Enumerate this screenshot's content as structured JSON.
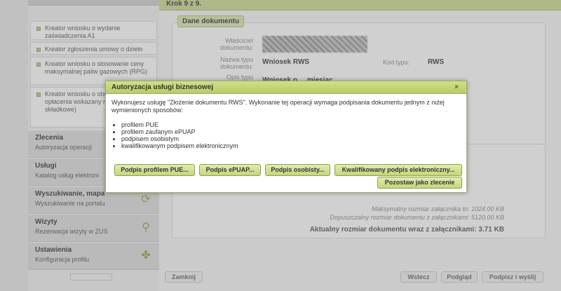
{
  "sidebar": {
    "subitems": [
      "Kreator wniosku o wydanie zaświadczenia A1",
      "Kreator zgłoszenia umowy o dzieło",
      "Kreator wniosku o stosowanie ceny maksymalnej paliw gazowych (RPG)",
      "Kreator wniosku o obowiązku opłacenia wskazany miesiąc – składkowe)"
    ],
    "sections": [
      {
        "title": "Zlecenia",
        "subtitle": "Autoryzacja operacji",
        "icon": ""
      },
      {
        "title": "Usługi",
        "subtitle": "Katalog usług elektroni",
        "icon": ""
      },
      {
        "title": "Wyszukiwanie, mapa",
        "subtitle": "Wyszukiwanie na portalu",
        "icon": "refresh-icon"
      },
      {
        "title": "Wizyty",
        "subtitle": "Rezerwacja wizyty w ZUS",
        "icon": "walking-person-icon"
      },
      {
        "title": "Ustawienia",
        "subtitle": "Konfiguracja profilu",
        "icon": "puzzle-icon"
      }
    ]
  },
  "main": {
    "step": "Krok 9 z 9.",
    "panel_title": "Dane dokumentu",
    "fields": {
      "owner_label": "Właściciel dokumentu:",
      "type_name_label": "Nazwa typu dokumentu:",
      "type_name_value": "Wniosek RWS",
      "type_code_label": "Kod typu:",
      "type_code_value": "RWS",
      "desc_label": "Opis typu",
      "desc_value": "Wniosek o ... miesiąc"
    },
    "info": {
      "max_attachment": "Maksymalny rozmiar załącznika to: 1024.00 KB",
      "max_total": "Dopuszczalny rozmiar dokumentu z załącznikami: 5120.00 KB",
      "current_size": "Aktualny rozmiar dokumentu wraz z załącznikami: 3.71 KB"
    },
    "buttons": {
      "close": "Zamknij",
      "back": "Wstecz",
      "preview": "Podgląd",
      "sign_send": "Podpisz i wyślij"
    }
  },
  "modal": {
    "title": "Autoryzacja usługi biznesowej",
    "close": "×",
    "message": "Wykonujesz usługę \"Złożenie dokumentu RWS\". Wykonanie tej operacji wymaga podpisania dokumentu jednym z niżej wymienionych sposobów:",
    "methods": [
      "profilem PUE",
      "profilem zaufanym ePUAP",
      "podpisem osobistym",
      "kwalifikowanym podpisem elektronicznym"
    ],
    "buttons": {
      "pue": "Podpis profilem PUE...",
      "epuap": "Podpis ePUAP...",
      "personal": "Podpis osobisty...",
      "qualified": "Kwalifikowany podpis elektroniczny...",
      "leave_order": "Pozostaw jako zlecenie"
    }
  },
  "colors": {
    "accent_green": "#c9d98f",
    "button_green": "#c3d77a",
    "border_green": "#8da046"
  }
}
